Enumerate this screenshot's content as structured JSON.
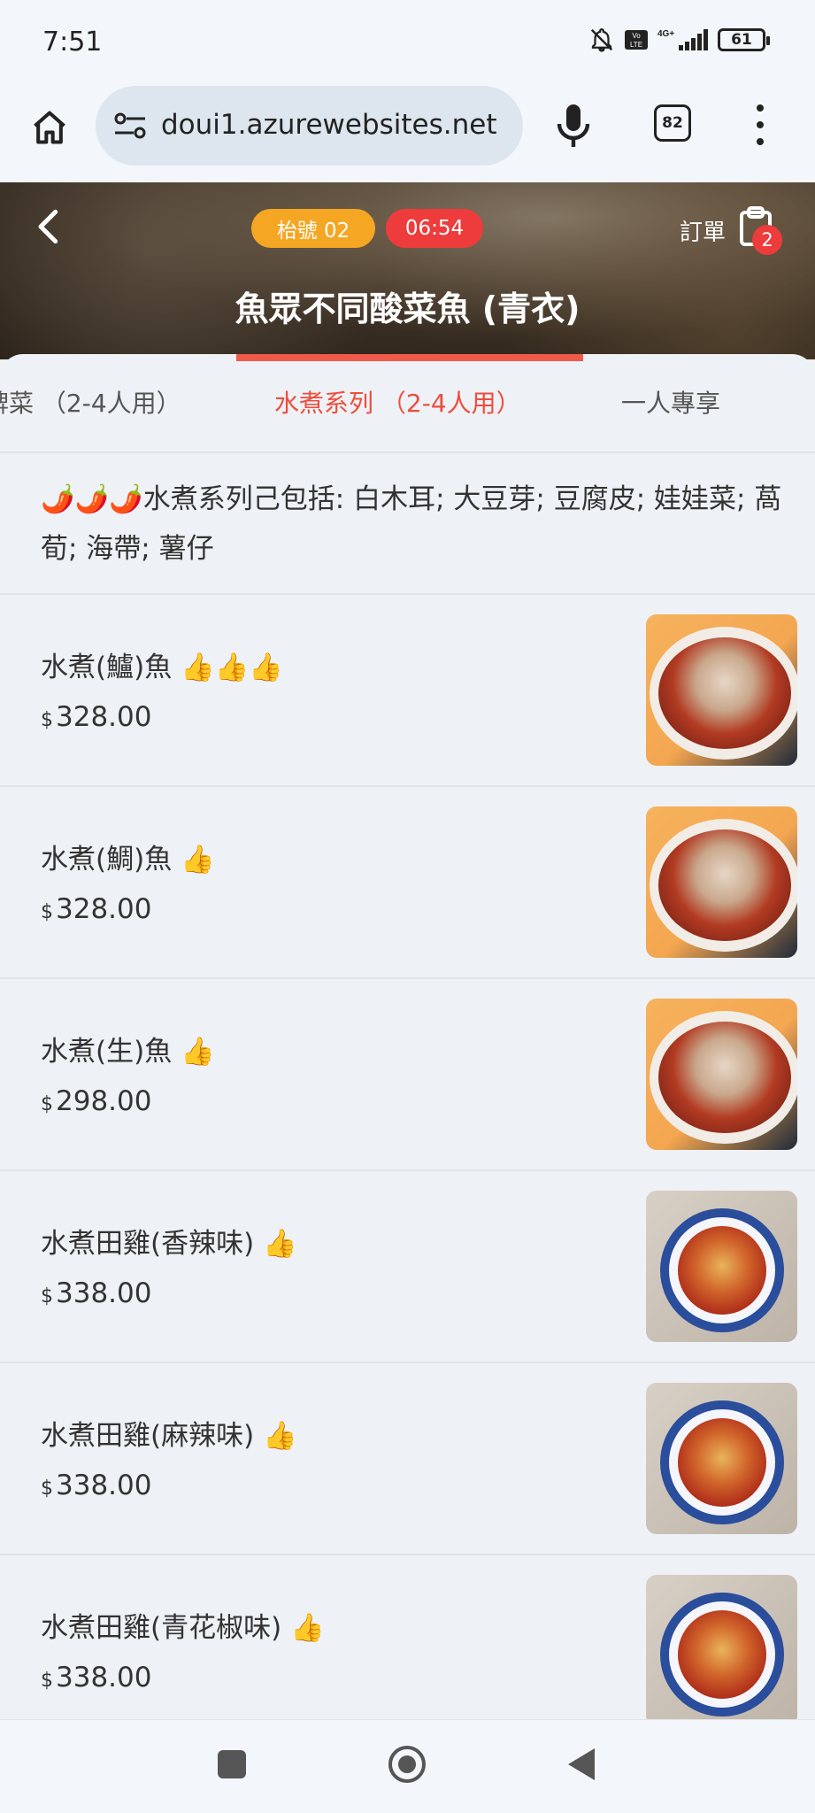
{
  "status_bar": {
    "time": "7:51",
    "battery": "61"
  },
  "browser": {
    "url": "doui1.azurewebsites.net",
    "tab_count": "82"
  },
  "header": {
    "table_label": "枱號 02",
    "timer": "06:54",
    "order_label": "訂單",
    "order_count": "2",
    "title": "魚眾不同酸菜魚 (青衣)"
  },
  "tabs": [
    {
      "label": "牌菜 （2-4人用）"
    },
    {
      "label": "水煮系列 （2-4人用）"
    },
    {
      "label": "一人專享"
    },
    {
      "label": ""
    }
  ],
  "active_tab": 1,
  "notice": "🌶️🌶️🌶️水煮系列己包括: 白木耳; 大豆芽; 豆腐皮; 娃娃菜; 萵荀; 海帶; 薯仔",
  "items": [
    {
      "name": "水煮(鱸)魚 👍👍👍",
      "currency": "$",
      "price": "328.00",
      "image": "fish-dish"
    },
    {
      "name": "水煮(鯛)魚 👍",
      "currency": "$",
      "price": "328.00",
      "image": "fish-dish"
    },
    {
      "name": "水煮(生)魚 👍",
      "currency": "$",
      "price": "298.00",
      "image": "fish-dish"
    },
    {
      "name": "水煮田雞(香辣味) 👍",
      "currency": "$",
      "price": "338.00",
      "image": "frog-dish"
    },
    {
      "name": "水煮田雞(麻辣味) 👍",
      "currency": "$",
      "price": "338.00",
      "image": "frog-dish"
    },
    {
      "name": "水煮田雞(青花椒味) 👍",
      "currency": "$",
      "price": "338.00",
      "image": "frog-dish"
    }
  ]
}
